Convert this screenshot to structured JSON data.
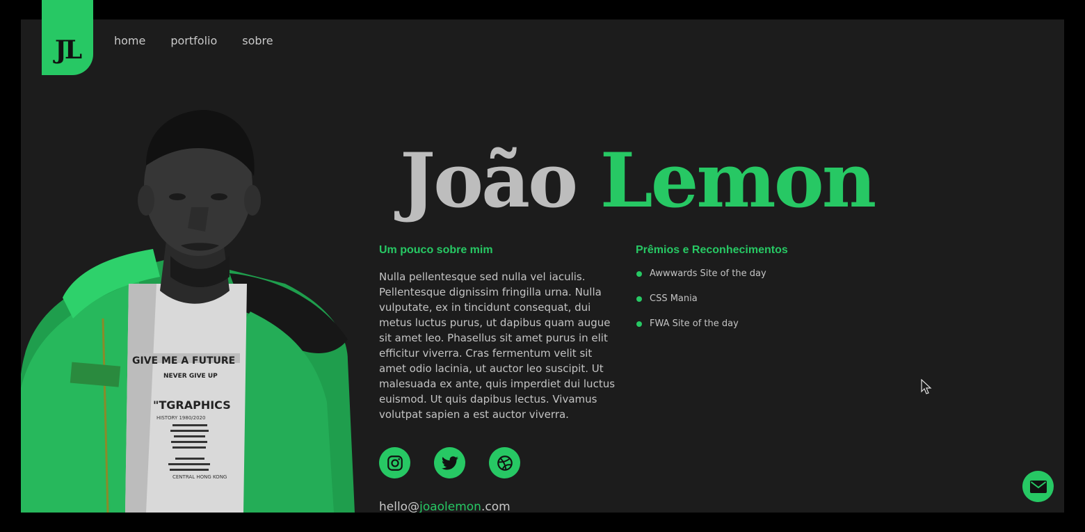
{
  "logo": {
    "text": "JL"
  },
  "nav": {
    "items": [
      "home",
      "portfolio",
      "sobre"
    ]
  },
  "hero": {
    "first_name": "João",
    "last_name": "Lemon"
  },
  "about": {
    "title": "Um pouco sobre mim",
    "text": "Nulla pellentesque sed nulla vel iaculis. Pellentesque dignissim fringilla urna. Nulla vulputate, ex in tincidunt consequat, dui metus luctus purus, ut dapibus quam augue sit amet leo. Phasellus sit amet purus in elit efficitur viverra. Cras fermentum velit sit amet odio lacinia, ut auctor leo suscipit. Ut malesuada ex ante, quis imperdiet dui luctus euismod. Ut quis dapibus lectus. Vivamus volutpat sapien a est auctor viverra."
  },
  "awards": {
    "title": "Prêmios e Reconhecimentos",
    "items": [
      "Awwwards Site of the day",
      "CSS Mania",
      "FWA Site of the day"
    ]
  },
  "social": {
    "icons": [
      "instagram-icon",
      "twitter-icon",
      "dribbble-icon"
    ]
  },
  "email": {
    "prefix": "hello@",
    "domain": "joaolemon",
    "suffix": ".com"
  },
  "portrait_tshirt": {
    "line1": "GIVE ME A FUTURE",
    "line2": "NEVER GIVE UP",
    "line3": "\"TGRAPHICS",
    "line4": "HISTORY 1980/2020",
    "line5": "CENTRAL HONG KONG"
  },
  "colors": {
    "accent": "#27c864",
    "background": "#1c1c1c",
    "muted_text": "#c4c4c4",
    "name_gray": "#bdbdbd"
  }
}
